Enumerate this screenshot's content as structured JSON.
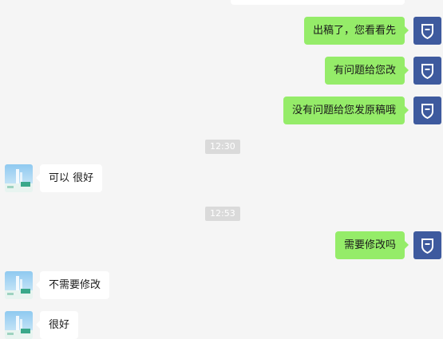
{
  "colors": {
    "outgoing_bubble": "#95ec69",
    "incoming_bubble": "#ffffff",
    "my_avatar": "#3e5a9e",
    "background": "#f5f5f5",
    "timestamp_bg": "#dadada"
  },
  "messages": [
    {
      "direction": "outgoing",
      "text": "出稿了，您看看先"
    },
    {
      "direction": "outgoing",
      "text": "有问题给您改"
    },
    {
      "direction": "outgoing",
      "text": "没有问题给您发原稿哦"
    },
    {
      "direction": "incoming",
      "text": "可以  很好"
    },
    {
      "direction": "outgoing",
      "text": "需要修改吗"
    },
    {
      "direction": "incoming",
      "text": "不需要修改"
    },
    {
      "direction": "incoming",
      "text": "很好"
    }
  ],
  "timestamps": [
    "12:30",
    "12:53"
  ],
  "icons": {
    "my_avatar": "shield-icon",
    "their_avatar": "landscape-photo-avatar"
  }
}
